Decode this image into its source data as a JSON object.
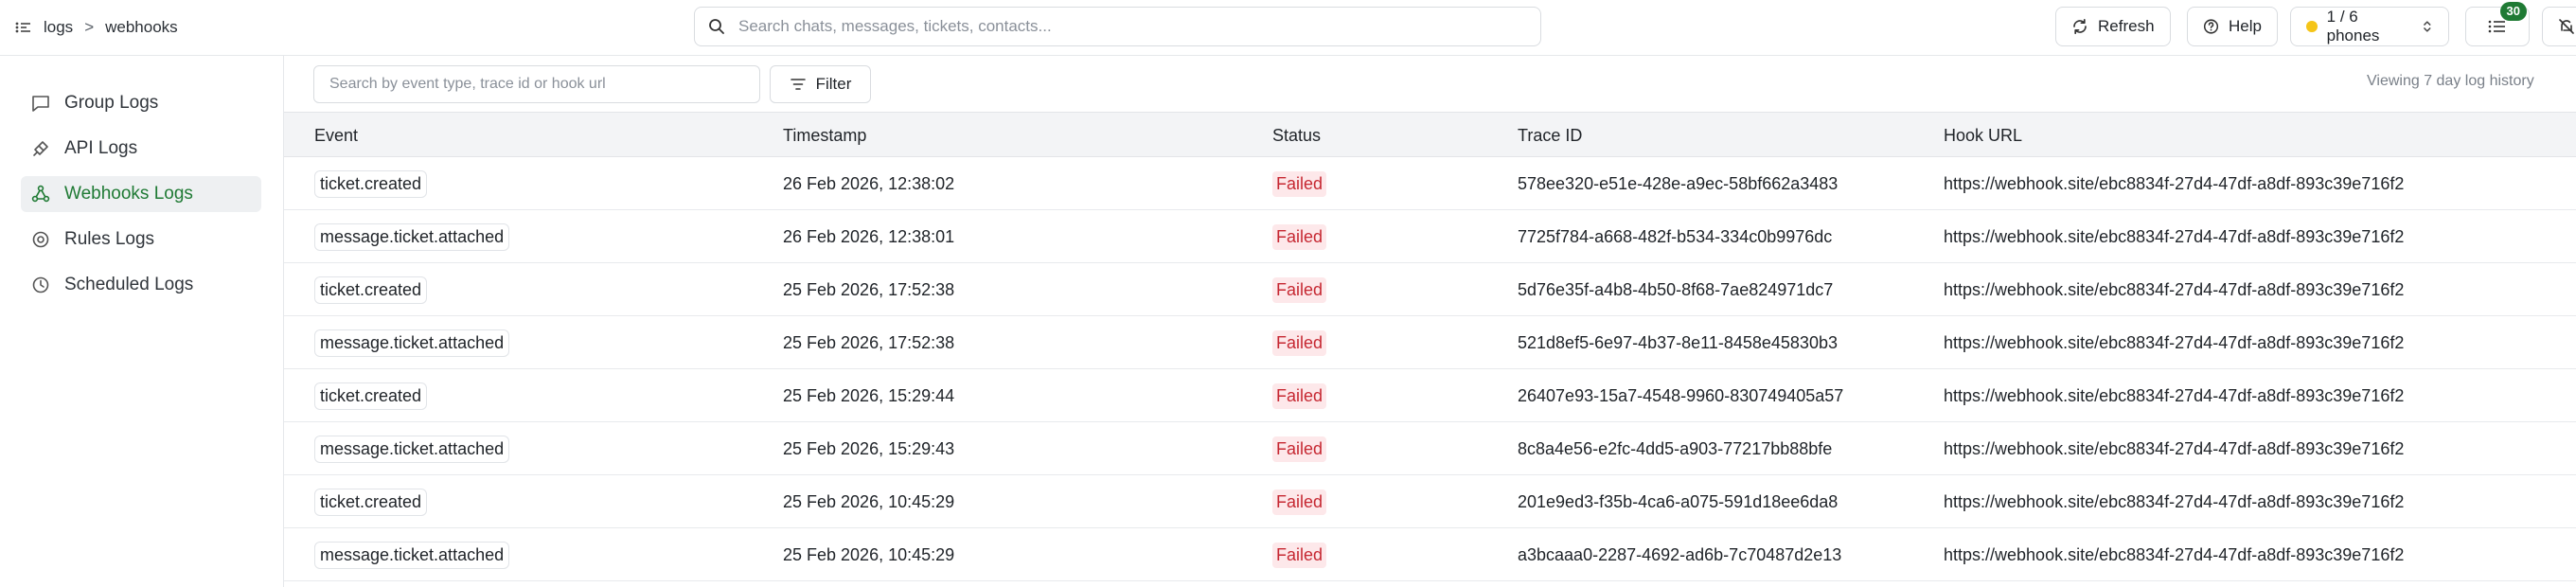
{
  "breadcrumb": {
    "root": "logs",
    "separator": ">",
    "current": "webhooks"
  },
  "top_search": {
    "placeholder": "Search chats, messages, tickets, contacts..."
  },
  "header_buttons": {
    "refresh": "Refresh",
    "help": "Help",
    "phones": "1 / 6 phones",
    "notifications_count": "30"
  },
  "sidebar": {
    "items": [
      {
        "label": "Group Logs",
        "icon": "message-square-icon",
        "active": false
      },
      {
        "label": "API Logs",
        "icon": "plug-icon",
        "active": false
      },
      {
        "label": "Webhooks Logs",
        "icon": "webhook-icon",
        "active": true
      },
      {
        "label": "Rules Logs",
        "icon": "target-icon",
        "active": false
      },
      {
        "label": "Scheduled Logs",
        "icon": "clock-icon",
        "active": false
      }
    ]
  },
  "toolbar": {
    "search_placeholder": "Search by event type, trace id or hook url",
    "filter_label": "Filter",
    "history_note": "Viewing 7 day log history"
  },
  "table": {
    "columns": [
      "Event",
      "Timestamp",
      "Status",
      "Trace ID",
      "Hook URL"
    ],
    "rows": [
      {
        "event": "ticket.created",
        "timestamp": "26 Feb 2026, 12:38:02",
        "status": "Failed",
        "trace_id": "578ee320-e51e-428e-a9ec-58bf662a3483",
        "hook_url": "https://webhook.site/ebc8834f-27d4-47df-a8df-893c39e716f2"
      },
      {
        "event": "message.ticket.attached",
        "timestamp": "26 Feb 2026, 12:38:01",
        "status": "Failed",
        "trace_id": "7725f784-a668-482f-b534-334c0b9976dc",
        "hook_url": "https://webhook.site/ebc8834f-27d4-47df-a8df-893c39e716f2"
      },
      {
        "event": "ticket.created",
        "timestamp": "25 Feb 2026, 17:52:38",
        "status": "Failed",
        "trace_id": "5d76e35f-a4b8-4b50-8f68-7ae824971dc7",
        "hook_url": "https://webhook.site/ebc8834f-27d4-47df-a8df-893c39e716f2"
      },
      {
        "event": "message.ticket.attached",
        "timestamp": "25 Feb 2026, 17:52:38",
        "status": "Failed",
        "trace_id": "521d8ef5-6e97-4b37-8e11-8458e45830b3",
        "hook_url": "https://webhook.site/ebc8834f-27d4-47df-a8df-893c39e716f2"
      },
      {
        "event": "ticket.created",
        "timestamp": "25 Feb 2026, 15:29:44",
        "status": "Failed",
        "trace_id": "26407e93-15a7-4548-9960-830749405a57",
        "hook_url": "https://webhook.site/ebc8834f-27d4-47df-a8df-893c39e716f2"
      },
      {
        "event": "message.ticket.attached",
        "timestamp": "25 Feb 2026, 15:29:43",
        "status": "Failed",
        "trace_id": "8c8a4e56-e2fc-4dd5-a903-77217bb88bfe",
        "hook_url": "https://webhook.site/ebc8834f-27d4-47df-a8df-893c39e716f2"
      },
      {
        "event": "ticket.created",
        "timestamp": "25 Feb 2026, 10:45:29",
        "status": "Failed",
        "trace_id": "201e9ed3-f35b-4ca6-a075-591d18ee6da8",
        "hook_url": "https://webhook.site/ebc8834f-27d4-47df-a8df-893c39e716f2"
      },
      {
        "event": "message.ticket.attached",
        "timestamp": "25 Feb 2026, 10:45:29",
        "status": "Failed",
        "trace_id": "a3bcaaa0-2287-4692-ad6b-7c70487d2e13",
        "hook_url": "https://webhook.site/ebc8834f-27d4-47df-a8df-893c39e716f2"
      }
    ]
  },
  "colors": {
    "accent": "#1f7a34",
    "status_failed_text": "#c62832",
    "status_failed_bg": "#fde8ea",
    "phone_status_dot": "#f5c518"
  }
}
